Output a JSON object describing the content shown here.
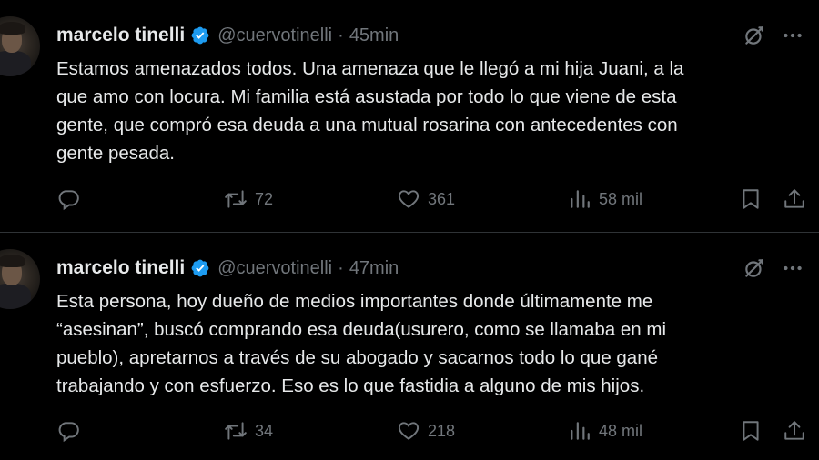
{
  "tweets": [
    {
      "author": "marcelo tinelli",
      "handle": "@cuervotinelli",
      "separator": "·",
      "time": "45min",
      "text": "Estamos amenazados todos. Una amenaza que le llegó a mi hija Juani, a la\nque amo con locura. Mi familia está asustada por todo lo que viene de esta\ngente, que compró esa deuda a una mutual rosarina con antecedentes con\ngente pesada.",
      "retweets": "72",
      "likes": "361",
      "views": "58 mil"
    },
    {
      "author": "marcelo tinelli",
      "handle": "@cuervotinelli",
      "separator": "·",
      "time": "47min",
      "text": "Esta persona, hoy dueño de medios importantes donde últimamente me\n“asesinan”, buscó comprando esa deuda(usurero, como se llamaba en mi\npueblo), apretarnos a través de su abogado y sacarnos todo lo que gané\ntrabajando y con esfuerzo. Eso es lo que fastidia a alguno de mis hijos.",
      "retweets": "34",
      "likes": "218",
      "views": "48 mil"
    }
  ],
  "icons": {
    "verified": "verified-badge-icon",
    "grok": "grok-icon",
    "more": "more-options-icon",
    "reply": "reply-icon",
    "retweet": "retweet-icon",
    "like": "like-icon",
    "views": "views-icon",
    "bookmark": "bookmark-icon",
    "share": "share-icon"
  },
  "colors": {
    "background": "#000000",
    "text": "#e7e9ea",
    "muted": "#71767b",
    "verified": "#1d9bf0",
    "divider": "#2f3336"
  }
}
